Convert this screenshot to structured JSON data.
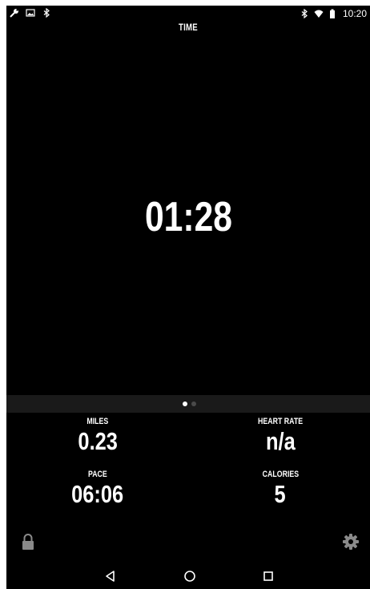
{
  "status_bar": {
    "left_icons": [
      "wrench-icon",
      "image-icon",
      "bluetooth-icon"
    ],
    "right_icons": [
      "bluetooth-icon",
      "wifi-icon",
      "battery-icon"
    ],
    "clock": "10:20"
  },
  "main": {
    "time_label": "TIME",
    "time_value": "01:28"
  },
  "pager": {
    "pages": 2,
    "active_index": 0
  },
  "stats": {
    "miles": {
      "label": "MILES",
      "value": "0.23"
    },
    "heart_rate": {
      "label": "HEART RATE",
      "value": "n/a"
    },
    "pace": {
      "label": "PACE",
      "value": "06:06"
    },
    "calories": {
      "label": "CALORIES",
      "value": "5"
    }
  },
  "controls": {
    "lock_icon": "lock-icon",
    "settings_icon": "gear-icon"
  },
  "nav_bar": {
    "icons": [
      "back-icon",
      "home-icon",
      "recents-icon"
    ]
  },
  "colors": {
    "background": "#000000",
    "text": "#ffffff",
    "pager_strip": "#1a1a1a",
    "icon_gray": "#8a8a8a",
    "dot_inactive": "#4a4a4a"
  }
}
